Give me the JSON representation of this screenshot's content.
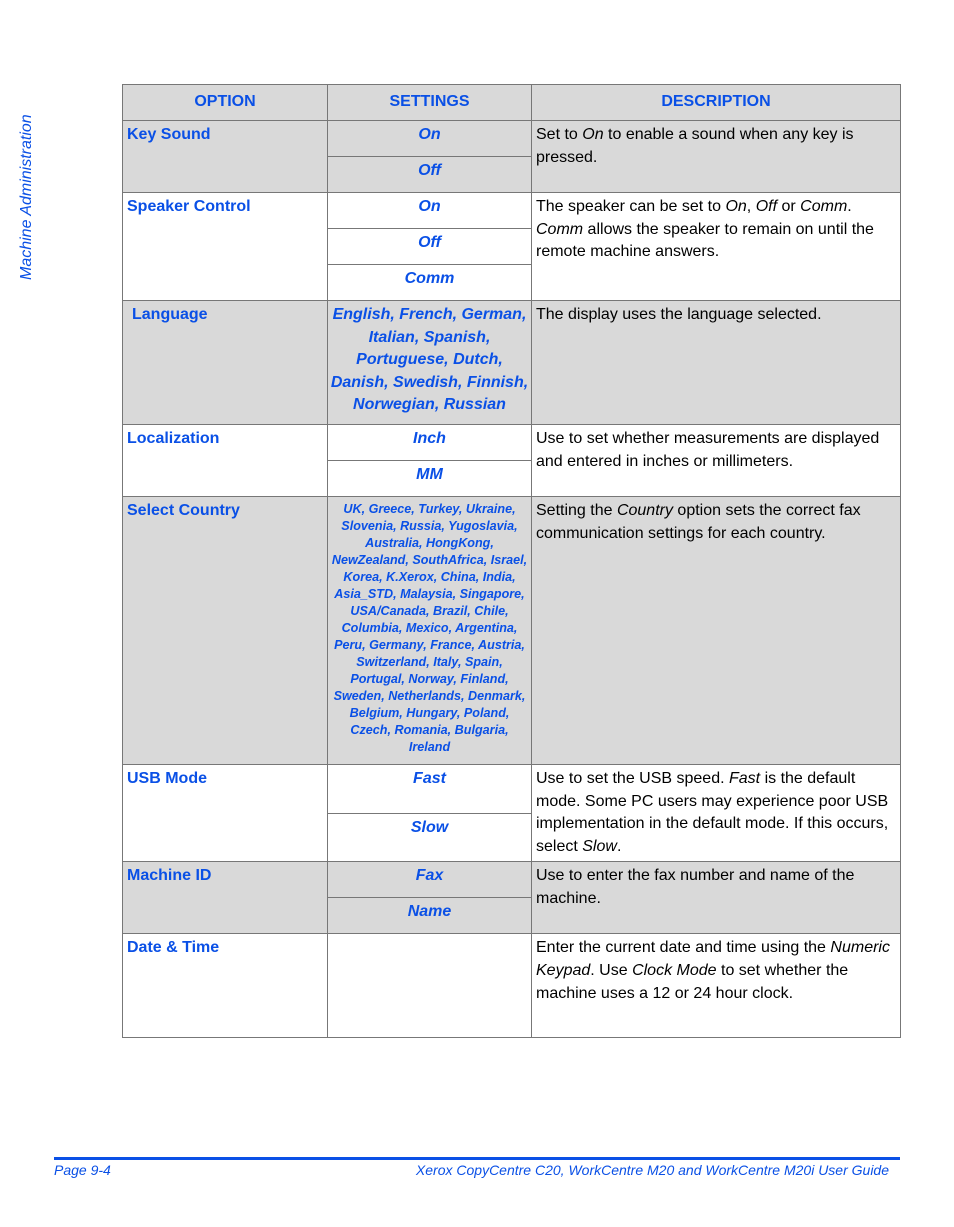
{
  "side_header": "Machine Administration",
  "table": {
    "headers": [
      "OPTION",
      "SETTINGS",
      "DESCRIPTION"
    ],
    "rows": [
      {
        "option": "Key Sound",
        "settings": [
          "On",
          "Off"
        ],
        "description": [
          {
            "t": "Set to ",
            "i": false
          },
          {
            "t": "On",
            "i": true
          },
          {
            "t": " to enable a sound when any key is pressed.",
            "i": false
          }
        ]
      },
      {
        "option": "Speaker Control",
        "settings": [
          "On",
          "Off",
          "Comm"
        ],
        "description": [
          {
            "t": "The speaker can be set to ",
            "i": false
          },
          {
            "t": "On",
            "i": true
          },
          {
            "t": ", ",
            "i": false
          },
          {
            "t": "Off",
            "i": true
          },
          {
            "t": " or ",
            "i": false
          },
          {
            "t": "Comm",
            "i": true
          },
          {
            "t": ". ",
            "i": false
          },
          {
            "t": "Comm",
            "i": true
          },
          {
            "t": " allows the speaker to remain on until the remote machine answers.",
            "i": false
          }
        ]
      },
      {
        "option": "Language",
        "settings": [
          "English, French, German, Italian, Spanish, Portuguese, Dutch, Danish, Swedish, Finnish, Norwegian, Russian"
        ],
        "description": [
          {
            "t": "The display uses the language selected.",
            "i": false
          }
        ]
      },
      {
        "option": "Localization",
        "settings": [
          "Inch",
          "MM"
        ],
        "description": [
          {
            "t": "Use to set whether measurements are displayed and entered in inches or millimeters.",
            "i": false
          }
        ]
      },
      {
        "option": "Select Country",
        "settings": [
          "UK, Greece, Turkey, Ukraine, Slovenia, Russia, Yugoslavia, Australia, HongKong, NewZealand, SouthAfrica, Israel, Korea, K.Xerox, China, India, Asia_STD, Malaysia, Singapore, USA/Canada, Brazil, Chile, Columbia, Mexico, Argentina, Peru, Germany, France, Austria, Switzerland, Italy, Spain, Portugal, Norway, Finland, Sweden, Netherlands, Denmark, Belgium, Hungary, Poland, Czech, Romania, Bulgaria, Ireland"
        ],
        "description": [
          {
            "t": "Setting the ",
            "i": false
          },
          {
            "t": "Country",
            "i": true
          },
          {
            "t": " option sets the correct fax communication settings for each country.",
            "i": false
          }
        ]
      },
      {
        "option": "USB Mode",
        "settings": [
          "Fast",
          "Slow"
        ],
        "description": [
          {
            "t": "Use to set the USB speed. ",
            "i": false
          },
          {
            "t": "Fast",
            "i": true
          },
          {
            "t": " is the default mode. Some PC users may experience poor USB implementation in the default mode. If this occurs, select ",
            "i": false
          },
          {
            "t": "Slow",
            "i": true
          },
          {
            "t": ".",
            "i": false
          }
        ]
      },
      {
        "option": "Machine ID",
        "settings": [
          "Fax",
          "Name"
        ],
        "description": [
          {
            "t": "Use to enter the fax number and name of the machine.",
            "i": false
          }
        ]
      },
      {
        "option": "Date & Time",
        "settings": [],
        "description": [
          {
            "t": "Enter the current date and time using the ",
            "i": false
          },
          {
            "t": "Numeric Keypad",
            "i": true
          },
          {
            "t": ". Use ",
            "i": false
          },
          {
            "t": "Clock Mode",
            "i": true
          },
          {
            "t": " to set whether the machine uses a 12 or 24 hour clock.",
            "i": false
          }
        ]
      }
    ]
  },
  "footer": {
    "page": "Page 9-4",
    "title": "Xerox CopyCentre C20, WorkCentre M20 and WorkCentre M20i User Guide"
  }
}
